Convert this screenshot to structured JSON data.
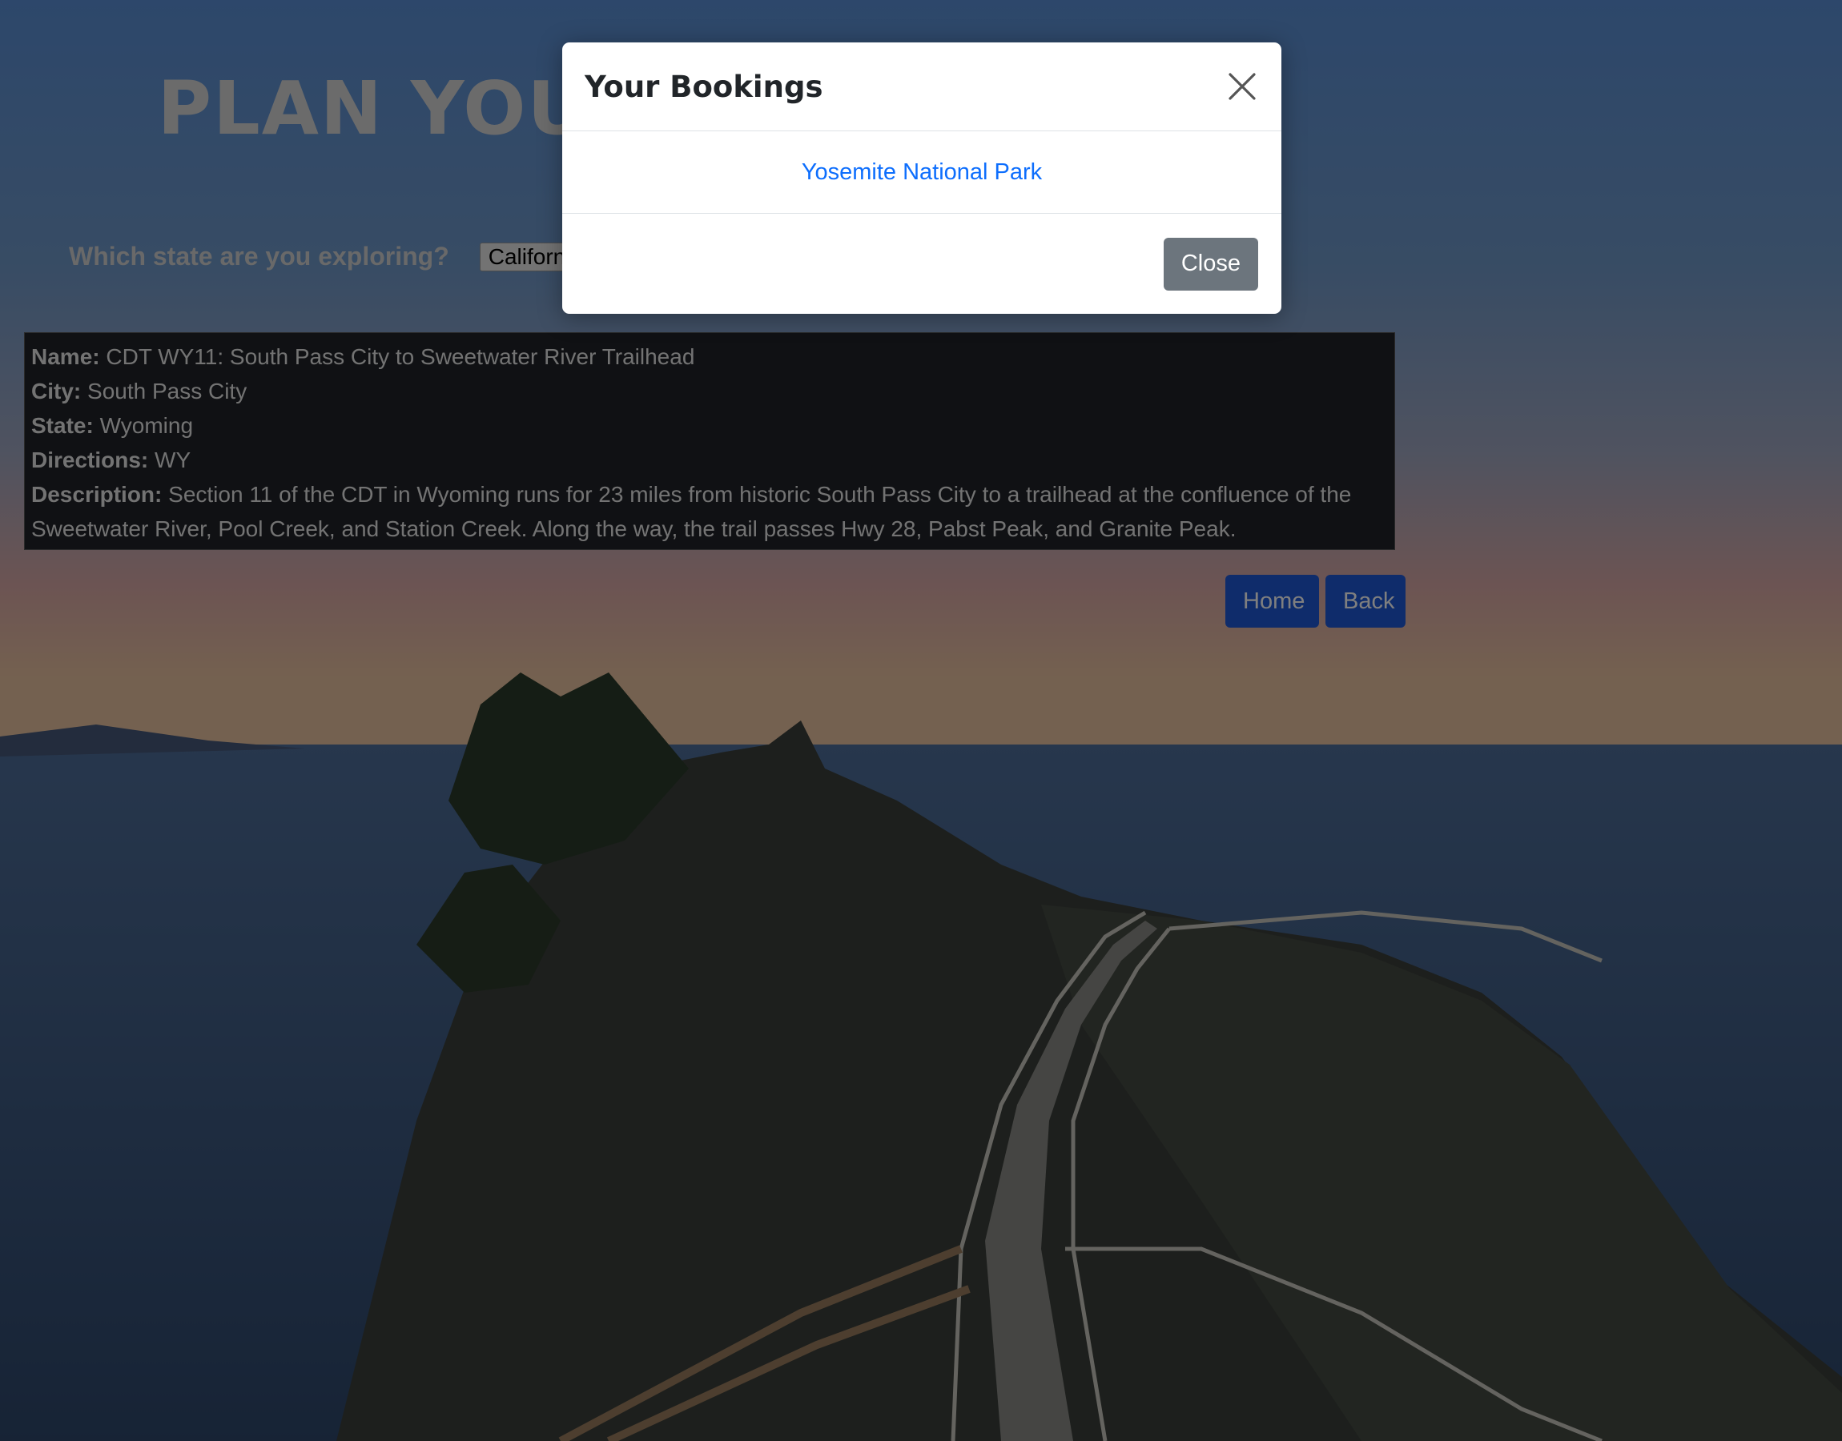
{
  "page": {
    "title": "PLAN YOUR EXPERIENCE!",
    "state_prompt": "Which state are you exploring?",
    "state_select": {
      "selected": "California"
    }
  },
  "trail": {
    "labels": {
      "name": "Name:",
      "city": "City:",
      "state": "State:",
      "directions": "Directions:",
      "description": "Description:"
    },
    "name": "CDT WY11: South Pass City to Sweetwater River Trailhead",
    "city": "South Pass City",
    "state": "Wyoming",
    "directions": "WY",
    "description": "Section 11 of the CDT in Wyoming runs for 23 miles from historic South Pass City to a trailhead at the confluence of the Sweetwater River, Pool Creek, and Station Creek. Along the way, the trail passes Hwy 28, Pabst Peak, and Granite Peak."
  },
  "nav": {
    "home_label": "Home",
    "back_label": "Back"
  },
  "modal": {
    "title": "Your Bookings",
    "bookings": [
      "Yosemite National Park"
    ],
    "close_label": "Close",
    "close_icon": "close-icon"
  },
  "colors": {
    "primary": "#1f58d6",
    "secondary": "#6c757d",
    "link": "#0d6efd"
  }
}
